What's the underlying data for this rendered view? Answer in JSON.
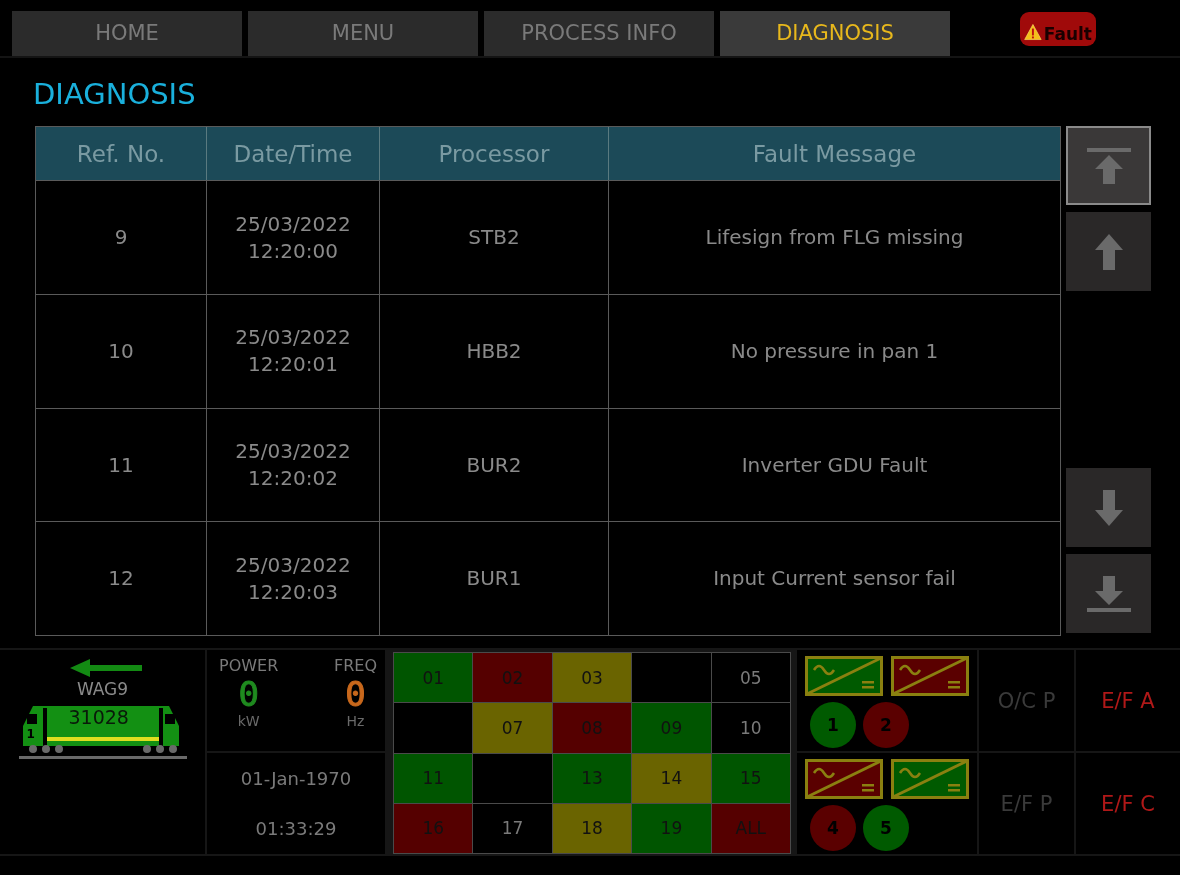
{
  "tabs": [
    {
      "label": "HOME",
      "selected": false
    },
    {
      "label": "MENU",
      "selected": false
    },
    {
      "label": "PROCESS INFO",
      "selected": false
    },
    {
      "label": "DIAGNOSIS",
      "selected": true
    }
  ],
  "fault_badge": {
    "label": "Fault",
    "active": true
  },
  "title": "DIAGNOSIS",
  "table": {
    "columns": [
      "Ref. No.",
      "Date/Time",
      "Processor",
      "Fault Message"
    ],
    "rows": [
      {
        "ref": "9",
        "date": "25/03/2022",
        "time": "12:20:00",
        "processor": "STB2",
        "message": "Lifesign from FLG missing"
      },
      {
        "ref": "10",
        "date": "25/03/2022",
        "time": "12:20:01",
        "processor": "HBB2",
        "message": "No pressure in pan 1"
      },
      {
        "ref": "11",
        "date": "25/03/2022",
        "time": "12:20:02",
        "processor": "BUR2",
        "message": "Inverter GDU Fault"
      },
      {
        "ref": "12",
        "date": "25/03/2022",
        "time": "12:20:03",
        "processor": "BUR1",
        "message": "Input Current sensor fail"
      }
    ]
  },
  "scroll_buttons": [
    {
      "kind": "top",
      "focused": true
    },
    {
      "kind": "up",
      "focused": false
    },
    {
      "kind": "down",
      "focused": false
    },
    {
      "kind": "bottom",
      "focused": false
    }
  ],
  "loco": {
    "name": "WAG9",
    "number": "31028",
    "cab": "1"
  },
  "meters": [
    {
      "label": "POWER",
      "value": "0",
      "unit": "kW",
      "color": "#1f8a1f"
    },
    {
      "label": "FREQ",
      "value": "0",
      "unit": "Hz",
      "color": "#c8681c"
    }
  ],
  "date": "01-Jan-1970",
  "time": "01:33:29",
  "status_grid": [
    {
      "label": "01",
      "color": "#005500"
    },
    {
      "label": "02",
      "color": "#550000"
    },
    {
      "label": "03",
      "color": "#6a6400"
    },
    {
      "color": "#000000"
    },
    {
      "label": "05",
      "color": "#000000"
    },
    {
      "color": "#000000"
    },
    {
      "label": "07",
      "color": "#6a6400"
    },
    {
      "label": "08",
      "color": "#550000"
    },
    {
      "label": "09",
      "color": "#005500"
    },
    {
      "label": "10",
      "color": "#000000"
    },
    {
      "label": "11",
      "color": "#005500"
    },
    {
      "color": "#000000"
    },
    {
      "label": "13",
      "color": "#005500"
    },
    {
      "label": "14",
      "color": "#6a6400"
    },
    {
      "label": "15",
      "color": "#005500"
    },
    {
      "label": "16",
      "color": "#550000"
    },
    {
      "label": "17",
      "color": "#000000"
    },
    {
      "label": "18",
      "color": "#6a6400"
    },
    {
      "label": "19",
      "color": "#005500"
    },
    {
      "label": "ALL",
      "color": "#550000"
    }
  ],
  "converter_groups": [
    {
      "converters": [
        {
          "color": "#005a00"
        },
        {
          "color": "#5a0000"
        }
      ],
      "units": [
        {
          "label": "1",
          "color": "#005a00"
        },
        {
          "label": "2",
          "color": "#5a0000"
        }
      ]
    },
    {
      "converters": [
        {
          "color": "#5a0000"
        },
        {
          "color": "#005a00"
        }
      ],
      "units": [
        {
          "label": "4",
          "color": "#5a0000"
        },
        {
          "label": "5",
          "color": "#005a00"
        }
      ]
    }
  ],
  "indicators": [
    {
      "label": "O/C P",
      "active": false
    },
    {
      "label": "E/F A",
      "active": true
    },
    {
      "label": "E/F P",
      "active": false
    },
    {
      "label": "E/F C",
      "active": true
    }
  ]
}
